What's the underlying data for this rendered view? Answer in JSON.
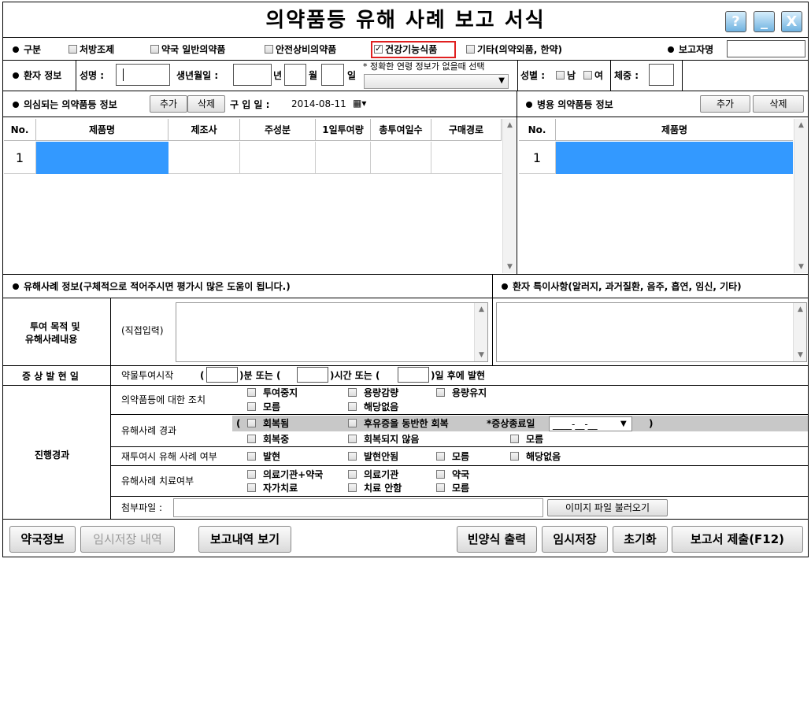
{
  "window": {
    "title": "의약품등 유해 사례 보고 서식",
    "help": "?",
    "minimize": "_",
    "close": "X"
  },
  "category": {
    "label": "구분",
    "options": [
      "처방조제",
      "약국 일반의약품",
      "안전상비의약품",
      "건강기능식품",
      "기타(의약외품, 한약)"
    ],
    "checked": "건강기능식품",
    "reporter_label": "보고자명",
    "reporter_value": ""
  },
  "patient": {
    "section_label": "환자 정보",
    "name_label": "성명 :",
    "name_value": "",
    "birth_label": "생년월일 :",
    "year_unit": "년",
    "month_unit": "월",
    "day_unit": "일",
    "age_note": "* 정확한 연령 정보가 없을때 선택",
    "age_select": "",
    "gender_label": "성별 :",
    "male": "남",
    "female": "여",
    "weight_label": "체중 :",
    "weight_value": ""
  },
  "suspect": {
    "section_label": "의심되는 의약품등 정보",
    "add": "추가",
    "delete": "삭제",
    "purchase_label": "구 입 일 :",
    "purchase_date": "2014-08-11",
    "columns": [
      "No.",
      "제품명",
      "제조사",
      "주성분",
      "1일투여량",
      "총투여일수",
      "구매경로"
    ],
    "rows": [
      {
        "no": "1",
        "name": "",
        "maker": "",
        "ingredient": "",
        "daily": "",
        "days": "",
        "route": ""
      }
    ]
  },
  "concomitant": {
    "section_label": "병용 의약품등 정보",
    "add": "추가",
    "delete": "삭제",
    "columns": [
      "No.",
      "제품명"
    ],
    "rows": [
      {
        "no": "1",
        "name": ""
      }
    ]
  },
  "adverse": {
    "section_label": "유해사례 정보(구체적으로 적어주시면 평가시 많은 도움이 됩니다.)",
    "special_label": "환자 특이사항(알러지, 과거질환, 음주, 흡연, 임신, 기타)",
    "purpose_label_1": "투여 목적 및",
    "purpose_label_2": "유해사례내용",
    "direct_input": "(직접입력)",
    "onset_label": "증 상 발 현 일",
    "onset_start": "약물투여시작",
    "onset_paren_open": "(",
    "onset_min": ")분 또는 (",
    "onset_hour": ")시간 또는 (",
    "onset_day": ")일 후에 발현"
  },
  "progress": {
    "label": "진행경과",
    "action_label": "의약품등에 대한 조치",
    "action_options": [
      "투여중지",
      "용량감량",
      "용량유지",
      "모름",
      "해당없음"
    ],
    "course_label": "유해사례 경과",
    "course_paren_open": "(",
    "course_paren_close": ")",
    "course_options": [
      "회복됨",
      "후유증을 동반한 회복",
      "회복중",
      "회복되지 않음",
      "모름"
    ],
    "end_date_label": "*증상종료일",
    "end_date_value": "____-__-__",
    "rechallenge_label": "재투여시 유해 사례 여부",
    "rechallenge_options": [
      "발현",
      "발현안됨",
      "모름",
      "해당없음"
    ],
    "treatment_label": "유해사례 치료여부",
    "treatment_options": [
      "의료기관+약국",
      "의료기관",
      "약국",
      "자가치료",
      "치료 안함",
      "모름"
    ],
    "attach_label": "첨부파일 :",
    "attach_button": "이미지 파일 불러오기"
  },
  "footer": {
    "pharmacy_info": "약국정보",
    "temp_history": "임시저장 내역",
    "view_history": "보고내역 보기",
    "print_blank": "빈양식 출력",
    "temp_save": "임시저장",
    "reset": "초기화",
    "submit": "보고서 제출(F12)"
  },
  "colors": {
    "selection": "#3399ff",
    "highlight_box": "#e02020",
    "grey_row": "#c8c8c8"
  }
}
